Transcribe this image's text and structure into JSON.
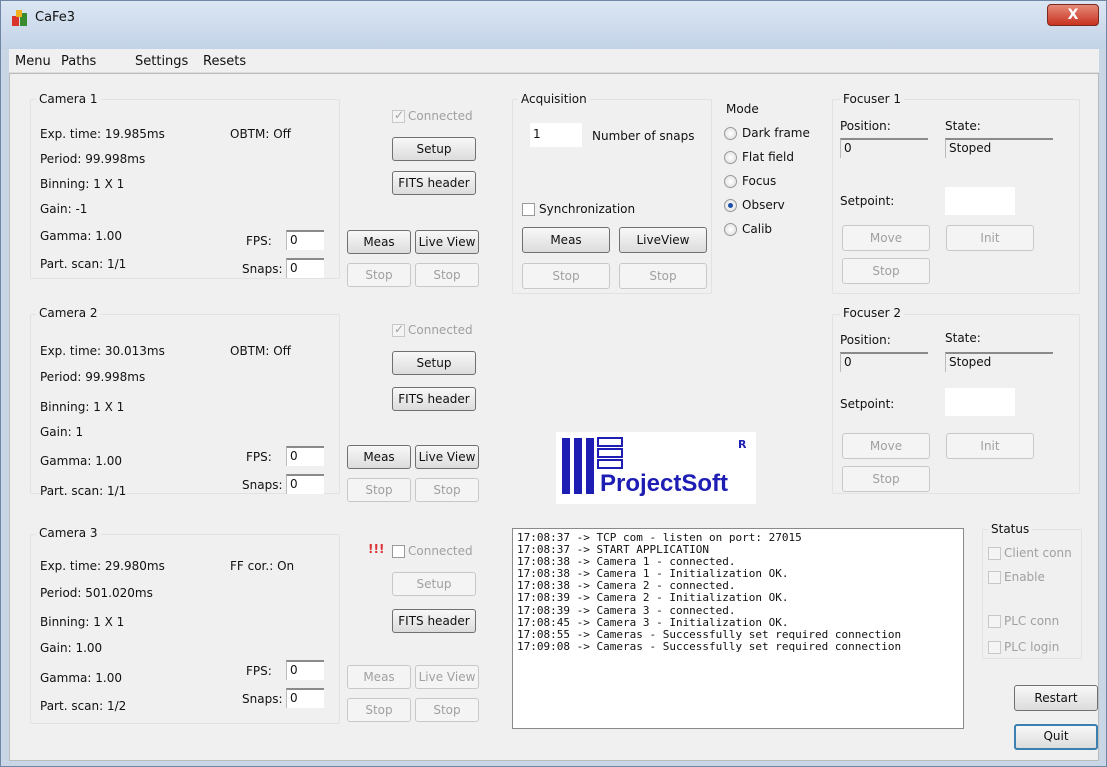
{
  "window": {
    "title": "CaFe3",
    "close_glyph": "X"
  },
  "menu": [
    "Menu",
    "Paths",
    "Settings",
    "Resets"
  ],
  "cameras": [
    {
      "title": "Camera 1",
      "exp": "Exp. time: 19.985ms",
      "period": "Period: 99.998ms",
      "binning": "Binning: 1 X 1",
      "gain": "Gain: -1",
      "gamma": "Gamma: 1.00",
      "part": "Part. scan: 1/1",
      "mode": "OBTM: Off",
      "fps_label": "FPS:",
      "fps": "0",
      "snaps_label": "Snaps:",
      "snaps": "0",
      "connected": "Connected",
      "warn": "",
      "setup": "Setup",
      "fits": "FITS header",
      "meas": "Meas",
      "live": "Live View",
      "stop1": "Stop",
      "stop2": "Stop"
    },
    {
      "title": "Camera 2",
      "exp": "Exp. time: 30.013ms",
      "period": "Period: 99.998ms",
      "binning": "Binning: 1 X 1",
      "gain": "Gain: 1",
      "gamma": "Gamma: 1.00",
      "part": "Part. scan: 1/1",
      "mode": "OBTM: Off",
      "fps_label": "FPS:",
      "fps": "0",
      "snaps_label": "Snaps:",
      "snaps": "0",
      "connected": "Connected",
      "warn": "",
      "setup": "Setup",
      "fits": "FITS header",
      "meas": "Meas",
      "live": "Live View",
      "stop1": "Stop",
      "stop2": "Stop"
    },
    {
      "title": "Camera 3",
      "exp": "Exp. time: 29.980ms",
      "period": "Period: 501.020ms",
      "binning": "Binning: 1 X 1",
      "gain": "Gain: 1.00",
      "gamma": "Gamma: 1.00",
      "part": "Part. scan: 1/2",
      "mode": "FF cor.: On",
      "fps_label": "FPS:",
      "fps": "0",
      "snaps_label": "Snaps:",
      "snaps": "0",
      "connected": "Connected",
      "warn": "!!!",
      "setup": "Setup",
      "fits": "FITS header",
      "meas": "Meas",
      "live": "Live View",
      "stop1": "Stop",
      "stop2": "Stop"
    }
  ],
  "acquisition": {
    "title": "Acquisition",
    "snaps_value": "1",
    "snaps_label": "Number of snaps",
    "sync": "Synchronization",
    "meas": "Meas",
    "live": "LiveView",
    "stop1": "Stop",
    "stop2": "Stop"
  },
  "mode": {
    "title": "Mode",
    "options": [
      "Dark frame",
      "Flat field",
      "Focus",
      "Observ",
      "Calib"
    ],
    "selected": "Observ"
  },
  "focusers": [
    {
      "title": "Focuser 1",
      "pos_label": "Position:",
      "pos": "0",
      "state_label": "State:",
      "state": "Stoped",
      "setpoint": "Setpoint:",
      "move": "Move",
      "init": "Init",
      "stop": "Stop"
    },
    {
      "title": "Focuser 2",
      "pos_label": "Position:",
      "pos": "0",
      "state_label": "State:",
      "state": "Stoped",
      "setpoint": "Setpoint:",
      "move": "Move",
      "init": "Init",
      "stop": "Stop"
    }
  ],
  "logo": {
    "text": "ProjectSoft",
    "mark": "R",
    "color": "#1e1eb4"
  },
  "log": [
    "17:08:37 -> TCP com - listen on port: 27015",
    "17:08:37 -> START APPLICATION",
    "17:08:38 -> Camera 1 - connected.",
    "17:08:38 -> Camera 1 - Initialization OK.",
    "17:08:38 -> Camera 2 - connected.",
    "17:08:39 -> Camera 2 - Initialization OK.",
    "17:08:39 -> Camera 3 - connected.",
    "17:08:45 -> Camera 3 - Initialization OK.",
    "17:08:55 -> Cameras - Successfully set required connection",
    "17:09:08 -> Cameras - Successfully set required connection"
  ],
  "status": {
    "title": "Status",
    "client": "Client conn",
    "enable": "Enable",
    "plc": "PLC conn",
    "plc_login": "PLC login"
  },
  "buttons": {
    "restart": "Restart",
    "quit": "Quit"
  }
}
